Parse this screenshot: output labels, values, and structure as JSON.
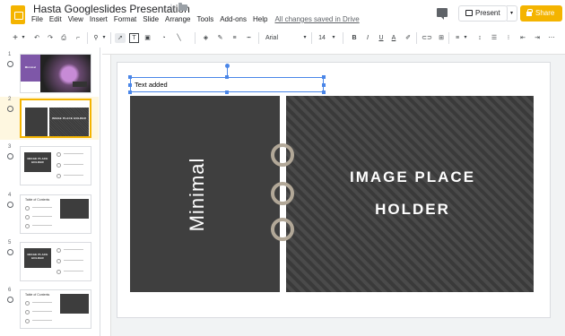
{
  "header": {
    "title": "Hasta Googleslides Presentation",
    "menus": [
      "File",
      "Edit",
      "View",
      "Insert",
      "Format",
      "Slide",
      "Arrange",
      "Tools",
      "Add-ons",
      "Help"
    ],
    "saved_status": "All changes saved in Drive",
    "present_label": "Present",
    "share_label": "Share",
    "brand_color": "#f4b400"
  },
  "toolbar": {
    "font": "Arial",
    "font_size": "14",
    "bold": "B",
    "italic": "I",
    "underline": "U",
    "add": "+",
    "undo": "↶",
    "redo": "↷",
    "zoom": "⚲",
    "font_color": "A"
  },
  "filmstrip": {
    "slides": [
      {
        "number": "1",
        "title": "Minimal"
      },
      {
        "number": "2",
        "title": "IMAGE PLACE HOLDER"
      },
      {
        "number": "3",
        "title": "IMAGE PLACE HOLDER"
      },
      {
        "number": "4",
        "title": "Table of Contents"
      },
      {
        "number": "5",
        "title": "IMAGE PLACE HOLDER"
      },
      {
        "number": "6",
        "title": "Table of Contents"
      }
    ],
    "selected_index": 1
  },
  "slide": {
    "textbox_text": "Text added",
    "left_title": "Minimal",
    "placeholder_line1": "IMAGE PLACE",
    "placeholder_line2": "HOLDER"
  }
}
